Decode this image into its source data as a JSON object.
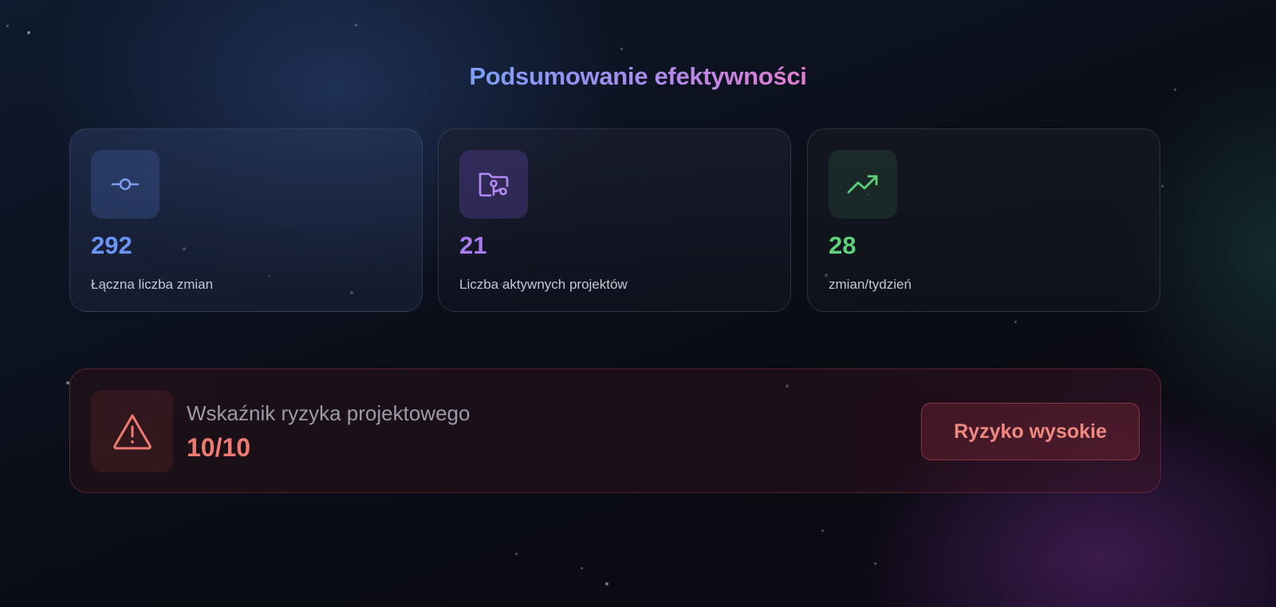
{
  "page": {
    "title": "Podsumowanie efektywności"
  },
  "stats": [
    {
      "value": "292",
      "label": "Łączna liczba zmian",
      "icon": "commit-icon",
      "color": "#6b93f5"
    },
    {
      "value": "21",
      "label": "Liczba aktywnych projektów",
      "icon": "folder-git-icon",
      "color": "#a97bef"
    },
    {
      "value": "28",
      "label": "zmian/tydzień",
      "icon": "trending-up-icon",
      "color": "#5fd07a"
    }
  ],
  "risk": {
    "title": "Wskaźnik ryzyka projektowego",
    "score": "10/10",
    "badge": "Ryzyko wysokie",
    "icon": "warning-triangle-icon",
    "color": "#ef7a72"
  }
}
